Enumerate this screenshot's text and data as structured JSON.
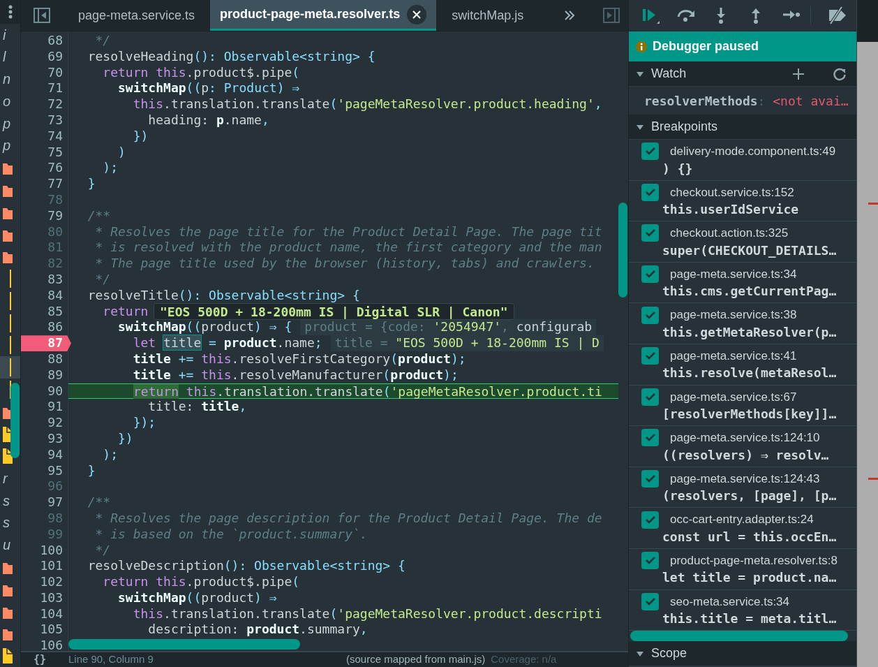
{
  "navigator": {
    "items": [
      {
        "kind": "label",
        "text": "i",
        "selected": false
      },
      {
        "kind": "label",
        "text": "l",
        "selected": false
      },
      {
        "kind": "label",
        "text": "n",
        "selected": false
      },
      {
        "kind": "label",
        "text": "o",
        "selected": false
      },
      {
        "kind": "label",
        "text": "p",
        "selected": false
      },
      {
        "kind": "label",
        "text": "p",
        "selected": false
      },
      {
        "kind": "folder",
        "selected": false
      },
      {
        "kind": "folder",
        "selected": false
      },
      {
        "kind": "folder",
        "selected": false
      },
      {
        "kind": "folder",
        "selected": false
      },
      {
        "kind": "folder",
        "selected": false
      },
      {
        "kind": "guide",
        "selected": false
      },
      {
        "kind": "guide",
        "selected": false
      },
      {
        "kind": "guide",
        "selected": false
      },
      {
        "kind": "guide",
        "selected": false
      },
      {
        "kind": "guide",
        "selected": true
      },
      {
        "kind": "guide",
        "selected": false
      },
      {
        "kind": "folder",
        "selected": false
      },
      {
        "kind": "file",
        "selected": false
      },
      {
        "kind": "file",
        "selected": false
      },
      {
        "kind": "label",
        "text": "r",
        "selected": false
      },
      {
        "kind": "label",
        "text": "s",
        "selected": false
      },
      {
        "kind": "label",
        "text": "s",
        "selected": false
      },
      {
        "kind": "label",
        "text": "u",
        "selected": false
      },
      {
        "kind": "folder",
        "selected": false
      },
      {
        "kind": "folder",
        "selected": false
      },
      {
        "kind": "folder",
        "selected": false
      },
      {
        "kind": "folder",
        "selected": false
      },
      {
        "kind": "file",
        "selected": false
      }
    ]
  },
  "tabs": [
    {
      "label": "page-meta.service.ts",
      "selected": false,
      "closable": false
    },
    {
      "label": "product-page-meta.resolver.ts",
      "selected": true,
      "closable": true
    },
    {
      "label": "switchMap.js",
      "selected": false,
      "closable": false
    }
  ],
  "code": {
    "lines": [
      {
        "number": "68",
        "dim": false,
        "kind": "code",
        "tokens": [
          {
            "kind": "comment",
            "text": "   */"
          }
        ]
      },
      {
        "number": "69",
        "dim": false,
        "kind": "code",
        "tokens": [
          {
            "kind": "plain",
            "text": "  resolveHeading"
          },
          {
            "kind": "type",
            "text": "(): Observable<string> {"
          }
        ]
      },
      {
        "number": "70",
        "dim": false,
        "kind": "code",
        "tokens": [
          {
            "kind": "kw",
            "text": "    return this"
          },
          {
            "kind": "plain",
            "text": ".product$.pipe"
          },
          {
            "kind": "punct",
            "text": "("
          }
        ]
      },
      {
        "number": "71",
        "dim": false,
        "kind": "code",
        "tokens": [
          {
            "kind": "bold",
            "text": "      switchMap"
          },
          {
            "kind": "punct",
            "text": "(("
          },
          {
            "kind": "plain",
            "text": "p"
          },
          {
            "kind": "punct",
            "text": ": "
          },
          {
            "kind": "type",
            "text": "Product) ⇒"
          }
        ]
      },
      {
        "number": "72",
        "dim": false,
        "kind": "code",
        "tokens": [
          {
            "kind": "kw",
            "text": "        this"
          },
          {
            "kind": "plain",
            "text": ".translation.translate"
          },
          {
            "kind": "punct",
            "text": "("
          },
          {
            "kind": "string",
            "text": "'pageMetaResolver.product.heading'"
          },
          {
            "kind": "punct",
            "text": ","
          }
        ]
      },
      {
        "number": "73",
        "dim": false,
        "kind": "code",
        "tokens": [
          {
            "kind": "plain",
            "text": "          heading: "
          },
          {
            "kind": "bold",
            "text": "p"
          },
          {
            "kind": "plain",
            "text": ".name"
          },
          {
            "kind": "punct",
            "text": ","
          }
        ]
      },
      {
        "number": "74",
        "dim": false,
        "kind": "code",
        "tokens": [
          {
            "kind": "punct",
            "text": "        })"
          }
        ]
      },
      {
        "number": "75",
        "dim": false,
        "kind": "code",
        "tokens": [
          {
            "kind": "punct",
            "text": "      )"
          }
        ]
      },
      {
        "number": "76",
        "dim": false,
        "kind": "code",
        "tokens": [
          {
            "kind": "punct",
            "text": "    );"
          }
        ]
      },
      {
        "number": "77",
        "dim": false,
        "kind": "code",
        "tokens": [
          {
            "kind": "punct",
            "text": "  }"
          }
        ]
      },
      {
        "number": "78",
        "dim": true,
        "kind": "code"
      },
      {
        "number": "79",
        "dim": false,
        "kind": "code",
        "tokens": [
          {
            "kind": "comment",
            "text": "  /**"
          }
        ]
      },
      {
        "number": "80",
        "dim": true,
        "kind": "code",
        "tokens": [
          {
            "kind": "comment",
            "text": "   * Resolves the page title for the Product Detail Page. The page tit"
          }
        ]
      },
      {
        "number": "81",
        "dim": true,
        "kind": "code",
        "tokens": [
          {
            "kind": "comment",
            "text": "   * is resolved with the product name, the first category and the man"
          }
        ]
      },
      {
        "number": "82",
        "dim": true,
        "kind": "code",
        "tokens": [
          {
            "kind": "comment",
            "text": "   * The page title used by the browser (history, tabs) and crawlers."
          }
        ]
      },
      {
        "number": "83",
        "dim": false,
        "kind": "code",
        "tokens": [
          {
            "kind": "comment",
            "text": "   */"
          }
        ]
      },
      {
        "number": "84",
        "dim": false,
        "kind": "code",
        "tokens": [
          {
            "kind": "plain",
            "text": "  resolveTitle"
          },
          {
            "kind": "type",
            "text": "(): Observable<string> {"
          }
        ]
      },
      {
        "number": "85",
        "dim": false,
        "kind": "code",
        "tokens": [
          {
            "kind": "kw",
            "text": "    return"
          }
        ],
        "tooltip": "\"EOS 500D + 18-200mm IS | Digital SLR | Canon\""
      },
      {
        "number": "86",
        "dim": false,
        "kind": "code",
        "tokens": [
          {
            "kind": "bold",
            "text": "      switchMap"
          },
          {
            "kind": "punct",
            "text": "(("
          },
          {
            "kind": "plain",
            "text": "product"
          },
          {
            "kind": "punct",
            "text": ") ⇒ {"
          }
        ],
        "inline": [
          {
            "kind": "dimtext",
            "text": "product = {code: "
          },
          {
            "kind": "string",
            "text": "'2054947'"
          },
          {
            "kind": "dimtext",
            "text": ", "
          },
          {
            "kind": "plain",
            "text": "configurab"
          }
        ]
      },
      {
        "number": "87",
        "dim": false,
        "kind": "breakpoint",
        "tokens": [
          {
            "kind": "kw",
            "text": "        let "
          },
          {
            "kind": "selected",
            "text": "title"
          },
          {
            "kind": "punct",
            "text": " = "
          },
          {
            "kind": "bold",
            "text": "product"
          },
          {
            "kind": "plain",
            "text": ".name"
          },
          {
            "kind": "punct",
            "text": ";"
          }
        ],
        "inline": [
          {
            "kind": "dimtext",
            "text": "title = "
          },
          {
            "kind": "string",
            "text": "\"EOS 500D + 18-200mm IS | D"
          }
        ]
      },
      {
        "number": "88",
        "dim": false,
        "kind": "code",
        "tokens": [
          {
            "kind": "bold",
            "text": "        title"
          },
          {
            "kind": "punct",
            "text": " += "
          },
          {
            "kind": "kw",
            "text": "this"
          },
          {
            "kind": "plain",
            "text": ".resolveFirstCategory"
          },
          {
            "kind": "punct",
            "text": "("
          },
          {
            "kind": "bold",
            "text": "product"
          },
          {
            "kind": "punct",
            "text": ");"
          }
        ]
      },
      {
        "number": "89",
        "dim": false,
        "kind": "code",
        "tokens": [
          {
            "kind": "bold",
            "text": "        title"
          },
          {
            "kind": "punct",
            "text": " += "
          },
          {
            "kind": "kw",
            "text": "this"
          },
          {
            "kind": "plain",
            "text": ".resolveManufacturer"
          },
          {
            "kind": "punct",
            "text": "("
          },
          {
            "kind": "bold",
            "text": "product"
          },
          {
            "kind": "punct",
            "text": ");"
          }
        ]
      },
      {
        "number": "90",
        "dim": false,
        "kind": "paused",
        "tokens": [
          {
            "kind": "kw_hl",
            "text": "return"
          },
          {
            "kind": "kw",
            "text": " this"
          },
          {
            "kind": "plain",
            "text": ".translation.translate"
          },
          {
            "kind": "punct",
            "text": "("
          },
          {
            "kind": "string",
            "text": "'pageMetaResolver.product.ti"
          }
        ]
      },
      {
        "number": "91",
        "dim": false,
        "kind": "code",
        "tokens": [
          {
            "kind": "plain",
            "text": "          title: "
          },
          {
            "kind": "bold",
            "text": "title"
          },
          {
            "kind": "punct",
            "text": ","
          }
        ]
      },
      {
        "number": "92",
        "dim": false,
        "kind": "code",
        "tokens": [
          {
            "kind": "punct",
            "text": "        });"
          }
        ]
      },
      {
        "number": "93",
        "dim": false,
        "kind": "code",
        "tokens": [
          {
            "kind": "punct",
            "text": "      })"
          }
        ]
      },
      {
        "number": "94",
        "dim": false,
        "kind": "code",
        "tokens": [
          {
            "kind": "punct",
            "text": "    );"
          }
        ]
      },
      {
        "number": "95",
        "dim": false,
        "kind": "code",
        "tokens": [
          {
            "kind": "punct",
            "text": "  }"
          }
        ]
      },
      {
        "number": "96",
        "dim": true,
        "kind": "code"
      },
      {
        "number": "97",
        "dim": false,
        "kind": "code",
        "tokens": [
          {
            "kind": "comment",
            "text": "  /**"
          }
        ]
      },
      {
        "number": "98",
        "dim": true,
        "kind": "code",
        "tokens": [
          {
            "kind": "comment",
            "text": "   * Resolves the page description for the Product Detail Page. The de"
          }
        ]
      },
      {
        "number": "99",
        "dim": true,
        "kind": "code",
        "tokens": [
          {
            "kind": "comment",
            "text": "   * is based on the `product.summary`."
          }
        ]
      },
      {
        "number": "100",
        "dim": false,
        "kind": "code",
        "tokens": [
          {
            "kind": "comment",
            "text": "   */"
          }
        ]
      },
      {
        "number": "101",
        "dim": false,
        "kind": "code",
        "tokens": [
          {
            "kind": "plain",
            "text": "  resolveDescription"
          },
          {
            "kind": "type",
            "text": "(): Observable<string> {"
          }
        ]
      },
      {
        "number": "102",
        "dim": false,
        "kind": "code",
        "tokens": [
          {
            "kind": "kw",
            "text": "    return this"
          },
          {
            "kind": "plain",
            "text": ".product$.pipe"
          },
          {
            "kind": "punct",
            "text": "("
          }
        ]
      },
      {
        "number": "103",
        "dim": false,
        "kind": "code",
        "tokens": [
          {
            "kind": "bold",
            "text": "      switchMap"
          },
          {
            "kind": "punct",
            "text": "(("
          },
          {
            "kind": "plain",
            "text": "product"
          },
          {
            "kind": "punct",
            "text": ") ⇒"
          }
        ]
      },
      {
        "number": "104",
        "dim": false,
        "kind": "code",
        "tokens": [
          {
            "kind": "kw",
            "text": "        this"
          },
          {
            "kind": "plain",
            "text": ".translation.translate"
          },
          {
            "kind": "punct",
            "text": "("
          },
          {
            "kind": "string",
            "text": "'pageMetaResolver.product.descripti"
          }
        ]
      },
      {
        "number": "105",
        "dim": false,
        "kind": "code",
        "tokens": [
          {
            "kind": "plain",
            "text": "          description: "
          },
          {
            "kind": "bold",
            "text": "product"
          },
          {
            "kind": "plain",
            "text": ".summary"
          },
          {
            "kind": "punct",
            "text": ","
          }
        ]
      },
      {
        "number": "106",
        "dim": false,
        "kind": "code"
      }
    ]
  },
  "status_bar": {
    "format": "{}",
    "position": "Line 90, Column 9",
    "source": "(source mapped from main.js)",
    "coverage": "Coverage: n/a"
  },
  "debugger": {
    "toolbar": [
      {
        "kind": "resume"
      },
      {
        "kind": "step-over"
      },
      {
        "kind": "step-into"
      },
      {
        "kind": "step-out"
      },
      {
        "kind": "step"
      },
      {
        "kind": "deactivate"
      }
    ],
    "banner": "Debugger paused",
    "watch": {
      "title": "Watch",
      "expanded": true,
      "items": [
        {
          "name": "resolverMethods",
          "separator": ":",
          "value": "<not avai…"
        }
      ]
    },
    "breakpoints": {
      "title": "Breakpoints",
      "expanded": true,
      "items": [
        {
          "file": "delivery-mode.component.ts:49",
          "code": ") {}",
          "checked": true
        },
        {
          "file": "checkout.service.ts:152",
          "code": "this.userIdService",
          "checked": true
        },
        {
          "file": "checkout.action.ts:325",
          "code": "super(CHECKOUT_DETAILS…",
          "checked": true
        },
        {
          "file": "page-meta.service.ts:34",
          "code": "this.cms.getCurrentPag…",
          "checked": true
        },
        {
          "file": "page-meta.service.ts:38",
          "code": "this.getMetaResolver(p…",
          "checked": true
        },
        {
          "file": "page-meta.service.ts:41",
          "code": "this.resolve(metaResol…",
          "checked": true
        },
        {
          "file": "page-meta.service.ts:67",
          "code": "[resolverMethods[key]]…",
          "checked": true
        },
        {
          "file": "page-meta.service.ts:124:10",
          "code": "((resolvers) ⇒ resolv…",
          "checked": true
        },
        {
          "file": "page-meta.service.ts:124:43",
          "code": "(resolvers, [page], [p…",
          "checked": true
        },
        {
          "file": "occ-cart-entry.adapter.ts:24",
          "code": "const url = this.occEn…",
          "checked": true
        },
        {
          "file": "product-page-meta.resolver.ts:8",
          "code": "let title = product.na…",
          "checked": true
        },
        {
          "file": "seo-meta.service.ts:34",
          "code": "this.title = meta.titl…",
          "checked": true
        }
      ]
    },
    "scope": {
      "title": "Scope",
      "expanded": true
    }
  }
}
